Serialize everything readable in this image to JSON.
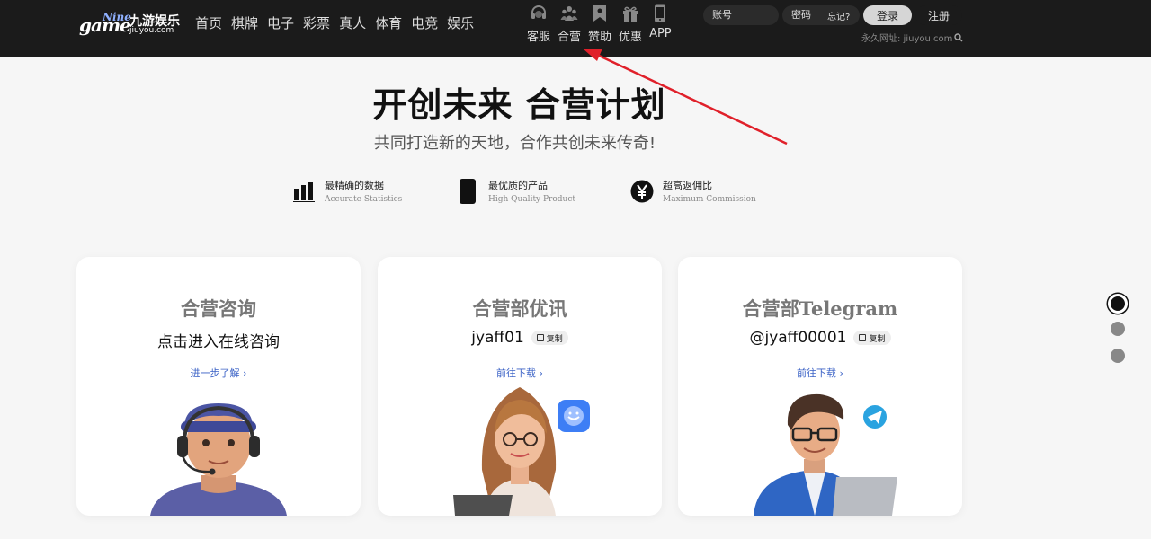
{
  "header": {
    "logo": {
      "game": "game",
      "nine": "Nine",
      "cn": "九游娱乐",
      "url": "jiuyou.com"
    },
    "main_nav": [
      {
        "label": "首页",
        "name": "nav-home"
      },
      {
        "label": "棋牌",
        "name": "nav-chess"
      },
      {
        "label": "电子",
        "name": "nav-electronic"
      },
      {
        "label": "彩票",
        "name": "nav-lottery"
      },
      {
        "label": "真人",
        "name": "nav-live"
      },
      {
        "label": "体育",
        "name": "nav-sports"
      },
      {
        "label": "电竞",
        "name": "nav-esports"
      },
      {
        "label": "娱乐",
        "name": "nav-entertainment"
      }
    ],
    "icon_nav": [
      {
        "label": "客服",
        "icon": "headset-icon"
      },
      {
        "label": "合营",
        "icon": "partners-icon"
      },
      {
        "label": "赞助",
        "icon": "bookmark-icon"
      },
      {
        "label": "优惠",
        "icon": "gift-icon"
      },
      {
        "label": "APP",
        "icon": "phone-icon"
      }
    ],
    "account_placeholder": "账号",
    "password_placeholder": "密码",
    "forgot": "忘记?",
    "login": "登录",
    "register": "注册",
    "permanent_url": "永久网址: jiuyou.com"
  },
  "hero": {
    "title": "开创未来 合营计划",
    "subtitle": "共同打造新的天地，合作共创未来传奇!"
  },
  "features": [
    {
      "title": "最精确的数据",
      "subtitle": "Accurate Statistics",
      "icon": "bar-chart-icon"
    },
    {
      "title": "最优质的产品",
      "subtitle": "High Quality Product",
      "icon": "phone-icon"
    },
    {
      "title": "超高返佣比",
      "subtitle": "Maximum Commission",
      "icon": "yen-icon"
    }
  ],
  "cards": [
    {
      "title": "合营咨询",
      "line": "点击进入在线咨询",
      "link": "进一步了解 ›",
      "copy": ""
    },
    {
      "title": "合营部优讯",
      "line": "jyaff01",
      "link": "前往下载 ›",
      "copy": "复制"
    },
    {
      "title_cn": "合营部",
      "title_en": "Telegram",
      "line": "@jyaff00001",
      "link": "前往下载 ›",
      "copy": "复制"
    }
  ],
  "colors": {
    "header_bg": "#1b1b1b",
    "link": "#3b62c6",
    "annotation_arrow": "#e0202a",
    "telegram": "#2aa3e0",
    "chat_app": "#3d7ef5"
  }
}
